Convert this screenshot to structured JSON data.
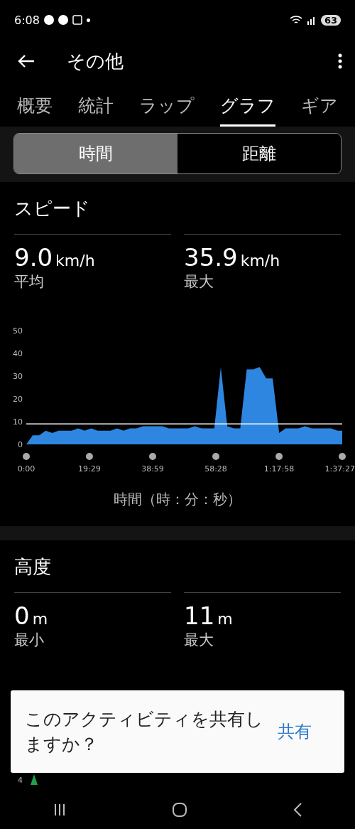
{
  "status_bar": {
    "time": "6:08",
    "battery": "63"
  },
  "app_bar": {
    "title": "その他"
  },
  "tabs": [
    {
      "label": "概要",
      "selected": false
    },
    {
      "label": "統計",
      "selected": false
    },
    {
      "label": "ラップ",
      "selected": false
    },
    {
      "label": "グラフ",
      "selected": true
    },
    {
      "label": "ギア",
      "selected": false
    }
  ],
  "segments": [
    {
      "label": "時間",
      "selected": true
    },
    {
      "label": "距離",
      "selected": false
    }
  ],
  "speed": {
    "title": "スピード",
    "stats": [
      {
        "value": "9.0",
        "unit": "km/h",
        "label": "平均"
      },
      {
        "value": "35.9",
        "unit": "km/h",
        "label": "最大"
      }
    ],
    "chart_data": {
      "type": "area",
      "xlabel": "時間（時：分：秒）",
      "xlim": [
        0,
        97.45
      ],
      "ylim": [
        0,
        50
      ],
      "yticks": [
        0,
        10,
        20,
        30,
        40,
        50
      ],
      "xticks": [
        {
          "value": 0,
          "label": "0:00"
        },
        {
          "value": 19.48,
          "label": "19:29"
        },
        {
          "value": 38.98,
          "label": "38:59"
        },
        {
          "value": 58.47,
          "label": "58:28"
        },
        {
          "value": 77.97,
          "label": "1:17:58"
        },
        {
          "value": 97.45,
          "label": "1:37:27"
        }
      ],
      "x": [
        0,
        2,
        4,
        6,
        8,
        10,
        12,
        14,
        16,
        18,
        20,
        22,
        24,
        26,
        28,
        30,
        32,
        34,
        36,
        38,
        40,
        42,
        44,
        46,
        48,
        50,
        52,
        54,
        56,
        58,
        60,
        62,
        64,
        66,
        68,
        70,
        72,
        74,
        76,
        78,
        80,
        82,
        84,
        86,
        88,
        90,
        92,
        94,
        96,
        97.45
      ],
      "series": [
        {
          "color": "#2f86e0",
          "values": [
            0,
            4,
            4,
            6,
            5,
            6,
            6,
            6,
            7,
            6,
            7,
            6,
            6,
            6,
            7,
            6,
            7,
            7,
            8,
            8,
            8,
            8,
            7,
            7,
            7,
            7,
            8,
            7,
            7,
            7,
            34,
            8,
            7,
            7,
            33,
            33,
            34,
            29,
            29,
            5,
            7,
            7,
            7,
            8,
            7,
            7,
            7,
            7,
            6,
            6
          ]
        }
      ],
      "ref_lines": [
        {
          "axis": "y",
          "value": 9.0
        }
      ]
    }
  },
  "altitude": {
    "title": "高度",
    "stats": [
      {
        "value": "0",
        "unit": "m",
        "label": "最小"
      },
      {
        "value": "11",
        "unit": "m",
        "label": "最大"
      }
    ],
    "tick_labels": [
      "4"
    ]
  },
  "toast": {
    "message": "このアクティビティを共有しますか？",
    "action": "共有"
  }
}
